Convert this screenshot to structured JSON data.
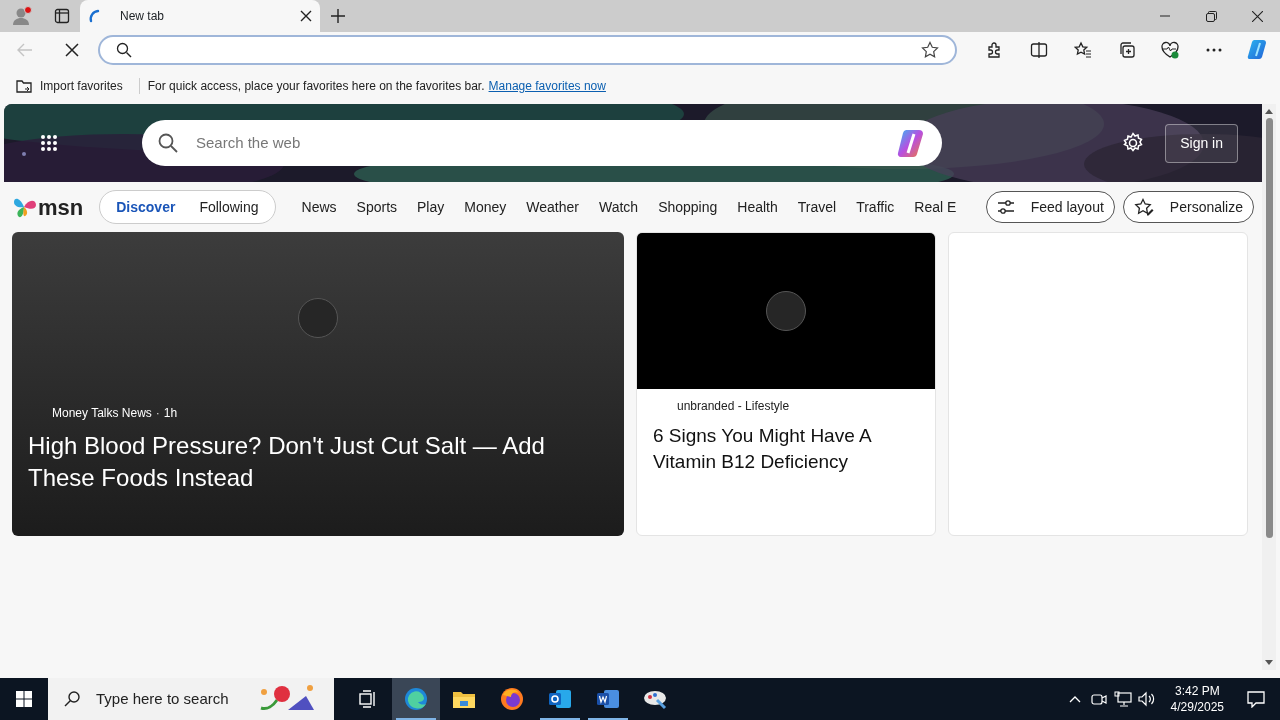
{
  "browser": {
    "tabs": [
      {
        "title": "New tab",
        "selected": true,
        "loading": true
      }
    ],
    "profile_notification": true
  },
  "toolbar": {
    "back_disabled": true,
    "loading": true
  },
  "favorites_bar": {
    "import": "Import favorites",
    "message": "For quick access, place your favorites here on the favorites bar.",
    "link": "Manage favorites now"
  },
  "msn": {
    "search": {
      "placeholder": "Search the web"
    },
    "sign_in": "Sign in",
    "logo": "msn",
    "feed_tabs": [
      {
        "label": "Discover",
        "selected": true
      },
      {
        "label": "Following",
        "selected": false
      }
    ],
    "categories": [
      "News",
      "Sports",
      "Play",
      "Money",
      "Weather",
      "Watch",
      "Shopping",
      "Health",
      "Travel",
      "Traffic",
      "Real E"
    ],
    "buttons": [
      {
        "kind": "layout",
        "label": "Feed layout"
      },
      {
        "kind": "personalize",
        "label": "Personalize"
      }
    ],
    "cards": [
      {
        "kind": "hero",
        "source": "Money Talks News",
        "separator": "·",
        "time": "1h",
        "title": "High Blood Pressure? Don't Just Cut Salt — Add These Foods Instead"
      },
      {
        "kind": "media",
        "source": "unbranded - Lifestyle",
        "title": "6 Signs You Might Have A Vitamin B12 Deficiency"
      },
      {
        "kind": "blank"
      }
    ]
  },
  "taskbar": {
    "search_placeholder": "Type here to search",
    "apps": [
      {
        "kind": "taskview",
        "selected": false,
        "running": false
      },
      {
        "kind": "edge",
        "selected": true,
        "running": true
      },
      {
        "kind": "explorer",
        "selected": false,
        "running": false
      },
      {
        "kind": "firefox",
        "selected": false,
        "running": false
      },
      {
        "kind": "outlook",
        "selected": false,
        "running": true
      },
      {
        "kind": "word",
        "selected": false,
        "running": true
      },
      {
        "kind": "paint",
        "selected": false,
        "running": false
      }
    ],
    "time": "3:42 PM",
    "date": "4/29/2025"
  }
}
